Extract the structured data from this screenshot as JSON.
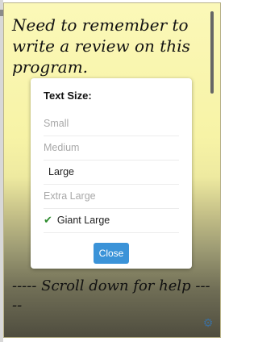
{
  "note": {
    "text": "Need to remember to write a review on this program.",
    "footer_text": "----- Scroll down for help -----"
  },
  "icons": {
    "settings": "gear-icon",
    "check": "check-icon"
  },
  "dialog": {
    "title": "Text Size:",
    "options": [
      {
        "label": "Small",
        "selected": false,
        "emphasized": false
      },
      {
        "label": "Medium",
        "selected": false,
        "emphasized": false
      },
      {
        "label": "Large",
        "selected": false,
        "emphasized": true
      },
      {
        "label": "Extra Large",
        "selected": false,
        "emphasized": false
      },
      {
        "label": "Giant Large",
        "selected": true,
        "emphasized": true
      }
    ],
    "close_label": "Close"
  },
  "colors": {
    "note_top": "#fbf8b8",
    "note_bottom": "#4f4d3f",
    "check": "#2e8b2e",
    "button": "#3b93d8",
    "gear": "#3d6e9a"
  }
}
